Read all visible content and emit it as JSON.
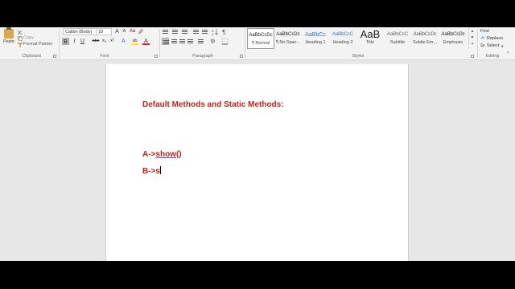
{
  "clipboard": {
    "paste_label": "Paste",
    "copy_label": "Copy",
    "format_painter_label": "Format Painter",
    "group_label": "Clipboard"
  },
  "font": {
    "name": "Calibri (Body)",
    "size": "18",
    "group_label": "Font",
    "bold": "B",
    "italic": "I",
    "underline": "U",
    "strikethrough": "abc",
    "subscript": "x₂",
    "superscript": "x²",
    "grow": "A",
    "shrink": "A",
    "case": "Aa",
    "text_effects": "A",
    "highlight": "ab",
    "font_color": "A"
  },
  "paragraph": {
    "group_label": "Paragraph"
  },
  "styles": {
    "group_label": "Styles",
    "items": [
      {
        "preview": "AaBbCcDc",
        "name": "¶ Normal"
      },
      {
        "preview": "AaBbCcDc",
        "name": "¶ No Spac..."
      },
      {
        "preview": "AaBbCc",
        "name": "Heading 1"
      },
      {
        "preview": "AaBbCcC",
        "name": "Heading 2"
      },
      {
        "preview": "AaB",
        "name": "Title"
      },
      {
        "preview": "AaBbCcC",
        "name": "Subtitle"
      },
      {
        "preview": "AaBbCcDc",
        "name": "Subtle Em..."
      },
      {
        "preview": "AaBbCcDc",
        "name": "Emphasis"
      }
    ]
  },
  "editing": {
    "find_label": "Find",
    "replace_label": "Replace",
    "select_label": "Select",
    "group_label": "Editing"
  },
  "document": {
    "heading": "Default Methods and Static Methods:",
    "line1_prefix": "A->",
    "line1_word": "show",
    "line1_suffix": "()",
    "line2": "B->s"
  },
  "colors": {
    "doc_text": "#c0221b",
    "ribbon_bg": "#f3f3f3",
    "canvas_bg": "#e7e7e7"
  }
}
